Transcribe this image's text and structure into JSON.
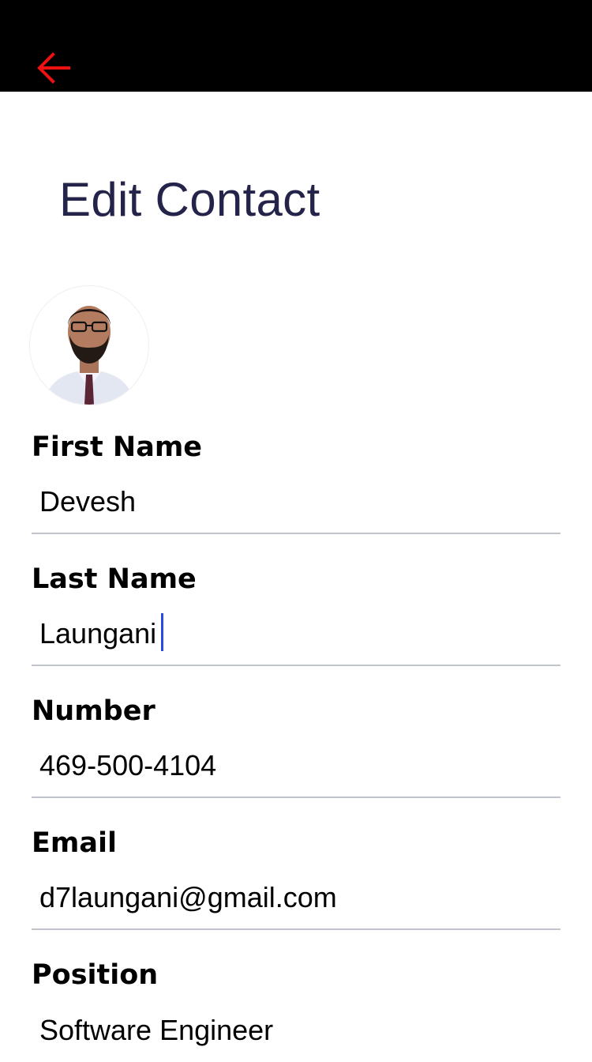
{
  "header": {
    "back_icon": "arrow-left-icon",
    "accent_color": "#ee1111"
  },
  "page": {
    "title": "Edit Contact"
  },
  "avatar": {
    "icon": "contact-photo"
  },
  "fields": {
    "first_name": {
      "label": "First Name",
      "value": "Devesh"
    },
    "last_name": {
      "label": "Last Name",
      "value": "Laungani"
    },
    "number": {
      "label": "Number",
      "value": "469-500-4104"
    },
    "email": {
      "label": "Email",
      "value": "d7laungani@gmail.com"
    },
    "position": {
      "label": "Position",
      "value": "Software Engineer"
    }
  }
}
